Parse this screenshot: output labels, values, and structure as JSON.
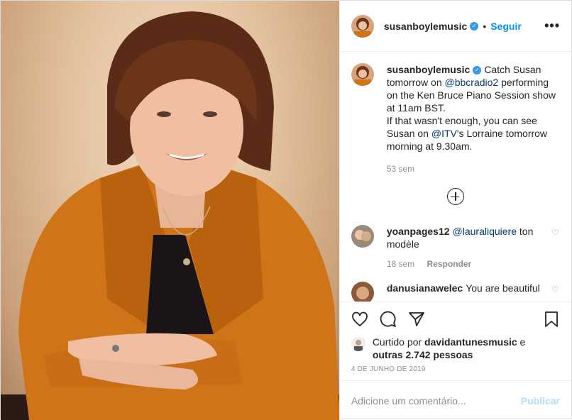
{
  "post": {
    "username": "susanboylemusic",
    "follow_label": "Seguir",
    "more_label": "•••",
    "caption_parts": {
      "a": "Catch Susan tomorrow on ",
      "m1": "@bbcradio2",
      "b": " performing on the Ken Bruce Piano Session show at 11am BST.",
      "c": "If that wasn't enough, you can see Susan on ",
      "m2": "@ITV",
      "d": "'s Lorraine tomorrow morning at 9.30am."
    },
    "caption_time": "53 sem",
    "load_more_icon": "plus-circle-icon"
  },
  "comments": [
    {
      "username": "yoanpages12",
      "mention": "@lauraliquiere",
      "text": " ton modèle",
      "time": "18 sem",
      "reply": "Responder"
    },
    {
      "username": "danusianawelec",
      "text": "You are beautiful"
    }
  ],
  "likes": {
    "prefix": "Curtido por ",
    "user": "davidantunesmusic",
    "middle": " e",
    "others": "outras 2.742 pessoas"
  },
  "date": "4 DE JUNHO DE 2019",
  "add_comment": {
    "placeholder": "Adicione um comentário...",
    "publish": "Publicar"
  },
  "colors": {
    "accent": "#0095f6",
    "verified": "#3897f0",
    "muted": "#8e8e8e",
    "jacket": "#d2761c"
  }
}
